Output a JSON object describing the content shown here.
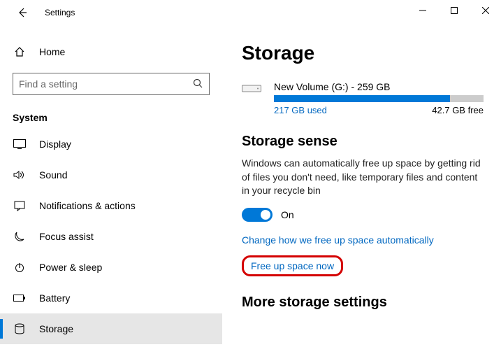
{
  "window": {
    "title": "Settings"
  },
  "sidebar": {
    "home": "Home",
    "search_placeholder": "Find a setting",
    "group": "System",
    "items": [
      {
        "label": "Display"
      },
      {
        "label": "Sound"
      },
      {
        "label": "Notifications & actions"
      },
      {
        "label": "Focus assist"
      },
      {
        "label": "Power & sleep"
      },
      {
        "label": "Battery"
      },
      {
        "label": "Storage"
      }
    ]
  },
  "page": {
    "title": "Storage",
    "drive": {
      "name": "New Volume (G:) - 259 GB",
      "used": "217 GB used",
      "free": "42.7 GB free",
      "fill_pct": 84
    },
    "sense": {
      "heading": "Storage sense",
      "desc": "Windows can automatically free up space by getting rid of files you don't need, like temporary files and content in your recycle bin",
      "toggle_state": "On",
      "link_change": "Change how we free up space automatically",
      "link_freeup": "Free up space now"
    },
    "more_heading": "More storage settings"
  }
}
